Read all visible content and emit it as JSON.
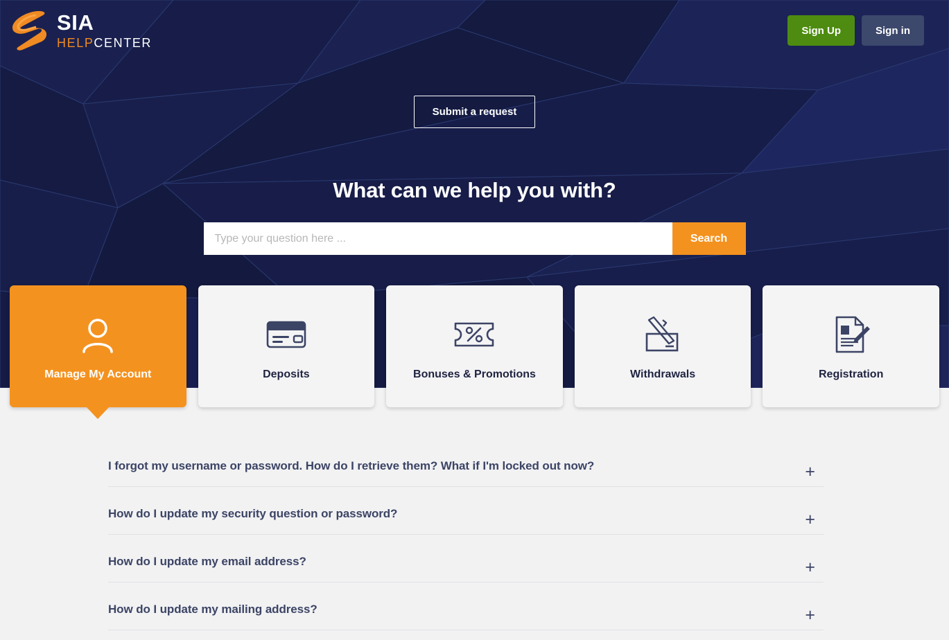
{
  "brand": {
    "logo_icon": "sia-s-logo-icon",
    "title": "SIA",
    "sub_help": "HELP",
    "sub_center": "CENTER"
  },
  "topbar": {
    "sign_up_label": "Sign Up",
    "sign_in_label": "Sign in"
  },
  "hero": {
    "submit_request_label": "Submit a request",
    "heading": "What can we help you with?",
    "search_placeholder": "Type your question here ...",
    "search_value": "",
    "search_button_label": "Search"
  },
  "categories": [
    {
      "label": "Manage My Account",
      "icon": "user-icon",
      "active": true
    },
    {
      "label": "Deposits",
      "icon": "credit-card-icon",
      "active": false
    },
    {
      "label": "Bonuses & Promotions",
      "icon": "coupon-percent-icon",
      "active": false
    },
    {
      "label": "Withdrawals",
      "icon": "check-pen-icon",
      "active": false
    },
    {
      "label": "Registration",
      "icon": "document-pencil-icon",
      "active": false
    }
  ],
  "faq": {
    "expand_icon": "plus-icon",
    "items": [
      {
        "question": "I forgot my username or password. How do I retrieve them? What if I'm locked out now?",
        "toggle": "+"
      },
      {
        "question": "How do I update my security question or password?",
        "toggle": "+"
      },
      {
        "question": "How do I update my email address?",
        "toggle": "+"
      },
      {
        "question": "How do I update my mailing address?",
        "toggle": "+"
      }
    ]
  },
  "colors": {
    "hero_navy": "#161c45",
    "accent_orange": "#f4921f",
    "brand_orange": "#f08a22",
    "signup_green": "#4d8c10",
    "signin_slate": "#3c486c",
    "page_bg": "#f2f2f3",
    "card_bg": "#f4f4f5",
    "text_navy": "#3c4465"
  }
}
